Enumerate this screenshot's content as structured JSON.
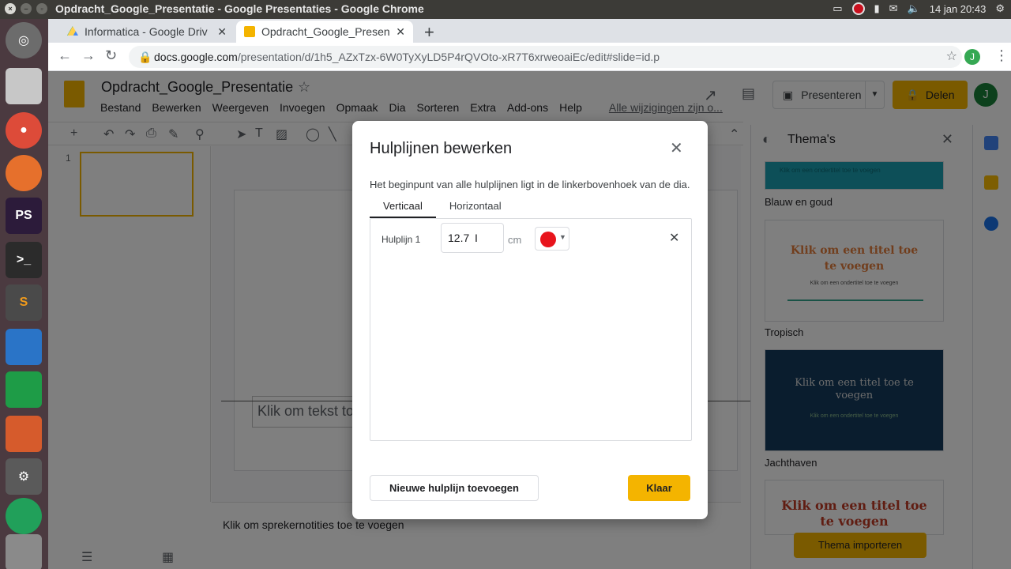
{
  "os": {
    "window_title": "Opdracht_Google_Presentatie - Google Presentaties - Google Chrome",
    "clock": "14 jan 20:43"
  },
  "browser": {
    "tabs": [
      {
        "label": "Informatica - Google Driv",
        "icon": "google-drive-icon"
      },
      {
        "label": "Opdracht_Google_Presen",
        "icon": "google-slides-icon"
      }
    ],
    "url_host": "docs.google.com",
    "url_path": "/presentation/d/1h5_AZxTzx-6W0TyXyLD5P4rQVOto-xR7T6xrweoaiEc/edit#slide=id.p",
    "profile_initial": "J"
  },
  "app": {
    "doc_title": "Opdracht_Google_Presentatie",
    "menu": [
      "Bestand",
      "Bewerken",
      "Weergeven",
      "Invoegen",
      "Opmaak",
      "Dia",
      "Sorteren",
      "Extra",
      "Add-ons",
      "Help"
    ],
    "save_status": "Alle wijzigingen zijn o...",
    "present_label": "Presenteren",
    "share_label": "Delen",
    "avatar_initial": "J",
    "slide_number": "1",
    "slide_placeholder": "Klik om tekst toe",
    "notes_placeholder": "Klik om sprekernotities toe te voegen",
    "accent": "#f4b400"
  },
  "themes": {
    "title": "Thema's",
    "items": [
      {
        "name": "Blauw en goud",
        "subtitle": "Klik om een ondertitel toe te voegen"
      },
      {
        "name": "Tropisch",
        "title": "Klik om een titel toe te voegen",
        "subtitle": "Klik om een ondertitel toe te voegen"
      },
      {
        "name": "Jachthaven",
        "title": "Klik om een titel toe te voegen",
        "subtitle": "Klik om een ondertitel toe te voegen"
      },
      {
        "title": "Klik om een titel toe te voegen"
      }
    ],
    "import_label": "Thema importeren"
  },
  "dialog": {
    "title": "Hulplijnen bewerken",
    "description": "Het beginpunt van alle hulplijnen ligt in de linkerbovenhoek van de dia.",
    "tabs": [
      "Verticaal",
      "Horizontaal"
    ],
    "active_tab": "Verticaal",
    "guides": [
      {
        "label": "Hulplijn 1",
        "value": "12.7",
        "unit": "cm",
        "color": "#e8141c"
      }
    ],
    "add_button": "Nieuwe hulplijn toevoegen",
    "done_button": "Klaar"
  }
}
